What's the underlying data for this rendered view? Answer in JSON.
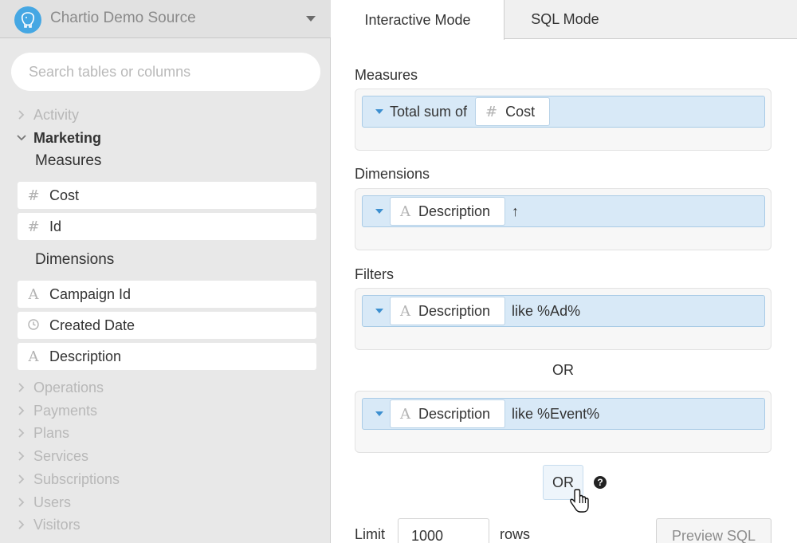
{
  "source": {
    "name": "Chartio Demo Source",
    "logo_icon": "elephant-icon"
  },
  "search": {
    "placeholder": "Search tables or columns"
  },
  "tree": {
    "collapsed_top": [
      "Activity"
    ],
    "open_table": "Marketing",
    "measures_label": "Measures",
    "measures": [
      {
        "type": "#",
        "name": "Cost"
      },
      {
        "type": "#",
        "name": "Id"
      }
    ],
    "dimensions_label": "Dimensions",
    "dimensions": [
      {
        "type": "A",
        "name": "Campaign Id"
      },
      {
        "type": "clock",
        "name": "Created Date"
      },
      {
        "type": "A",
        "name": "Description"
      }
    ],
    "collapsed_bottom": [
      "Operations",
      "Payments",
      "Plans",
      "Services",
      "Subscriptions",
      "Users",
      "Visitors"
    ]
  },
  "tabs": {
    "interactive": "Interactive Mode",
    "sql": "SQL Mode"
  },
  "query": {
    "measures_heading": "Measures",
    "measure": {
      "prefix": "Total sum of",
      "icon": "#",
      "field": "Cost"
    },
    "dimensions_heading": "Dimensions",
    "dimension": {
      "icon": "A",
      "field": "Description",
      "sort": "↑"
    },
    "filters_heading": "Filters",
    "filters": [
      {
        "icon": "A",
        "field": "Description",
        "condition": "like %Ad%"
      },
      {
        "icon": "A",
        "field": "Description",
        "condition": "like %Event%"
      }
    ],
    "or_separator": "OR",
    "or_button": "OR",
    "help": "?"
  },
  "footer": {
    "limit_label": "Limit",
    "limit_value": "1000",
    "rows_label": "rows",
    "preview_label": "Preview SQL"
  },
  "colors": {
    "accent": "#45a7e3",
    "pill_bg": "#d8e9f7",
    "panel_bg": "#e8e8e8"
  }
}
